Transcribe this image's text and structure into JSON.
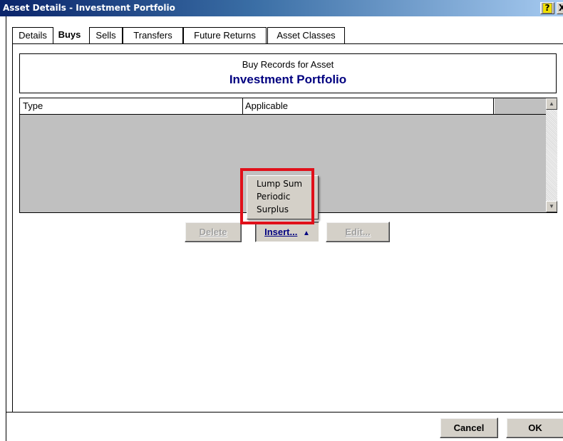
{
  "window": {
    "title": "Asset Details - Investment Portfolio",
    "help_label": "?",
    "close_label": "X"
  },
  "tabs": [
    {
      "label": "Details",
      "active": false
    },
    {
      "label": "Buys",
      "active": true
    },
    {
      "label": "Sells",
      "active": false
    },
    {
      "label": "Transfers",
      "active": false
    },
    {
      "label": "Future Returns",
      "active": false
    },
    {
      "label": "Asset Classes",
      "active": false
    }
  ],
  "header": {
    "subtitle": "Buy Records for Asset",
    "title": "Investment Portfolio"
  },
  "grid": {
    "columns": [
      "Type",
      "Applicable"
    ],
    "rows": []
  },
  "scrollbar": {
    "up_icon": "▲",
    "down_icon": "▼"
  },
  "actions": {
    "delete_label": "Delete",
    "insert_label": "Insert...",
    "insert_arrow": "▲",
    "edit_label": "Edit..."
  },
  "insert_menu": {
    "items": [
      "Lump Sum",
      "Periodic",
      "Surplus"
    ]
  },
  "footer": {
    "cancel_label": "Cancel",
    "ok_label": "OK"
  },
  "colors": {
    "title_text": "#000080",
    "highlight": "#e0101a",
    "grid_bg": "#c0c0c0"
  }
}
